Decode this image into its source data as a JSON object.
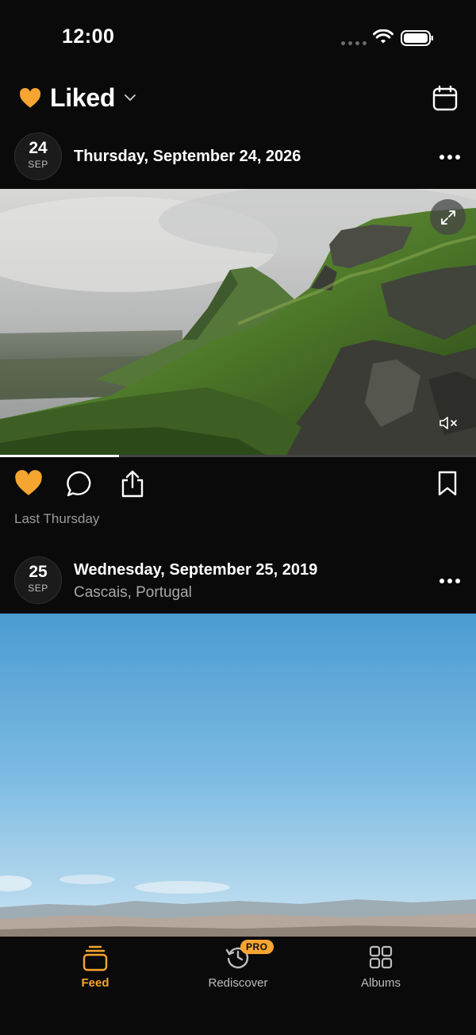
{
  "status_bar": {
    "time": "12:00"
  },
  "header": {
    "title": "Liked",
    "accent_color": "#f7a531"
  },
  "posts": [
    {
      "day": "24",
      "month": "SEP",
      "date": "Thursday, September 24, 2026",
      "location": "",
      "timestamp": "Last Thursday",
      "liked": true,
      "video_progress": 0.25
    },
    {
      "day": "25",
      "month": "SEP",
      "date": "Wednesday, September 25, 2019",
      "location": "Cascais, Portugal"
    }
  ],
  "tabs": [
    {
      "label": "Feed",
      "icon": "stack-icon",
      "active": true
    },
    {
      "label": "Rediscover",
      "icon": "history-icon",
      "badge": "PRO"
    },
    {
      "label": "Albums",
      "icon": "grid-icon"
    }
  ]
}
